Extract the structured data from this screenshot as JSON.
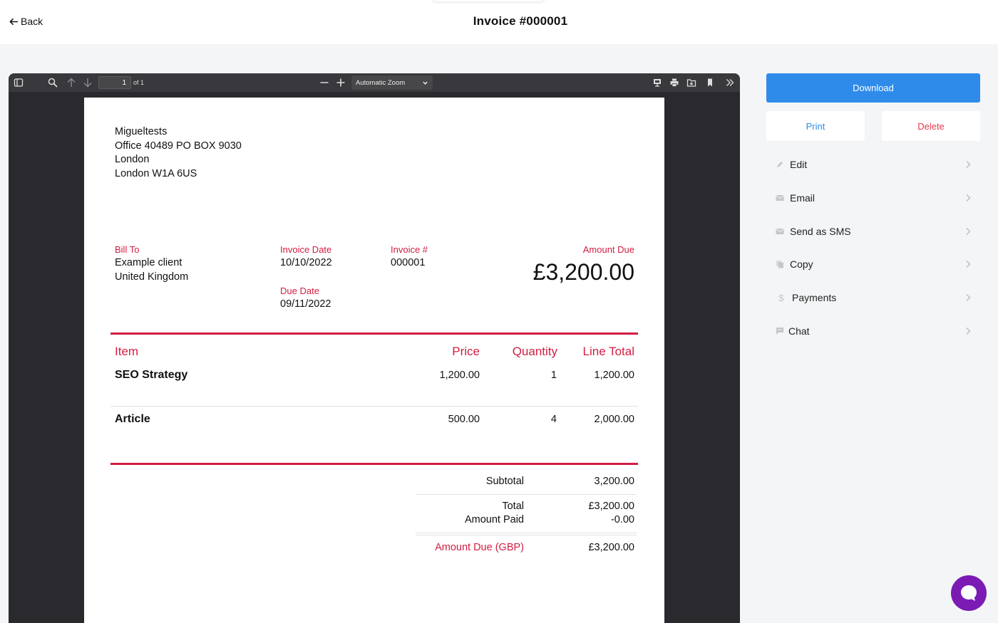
{
  "header": {
    "back_label": "Back",
    "title": "Invoice #000001"
  },
  "viewer": {
    "current_page": "1",
    "page_count_label": "of 1",
    "zoom_label": "Automatic Zoom"
  },
  "invoice": {
    "from": [
      "Migueltests",
      "Office 40489 PO BOX 9030",
      "London",
      "London W1A 6US"
    ],
    "bill_to_label": "Bill To",
    "bill_to": [
      "Example client",
      "United Kingdom"
    ],
    "invoice_date_label": "Invoice Date",
    "invoice_date": "10/10/2022",
    "due_date_label": "Due Date",
    "due_date": "09/11/2022",
    "invoice_no_label": "Invoice #",
    "invoice_no": "000001",
    "amount_due_label": "Amount Due",
    "amount_due": "£3,200.00",
    "columns": {
      "item": "Item",
      "price": "Price",
      "quantity": "Quantity",
      "line_total": "Line Total"
    },
    "items": [
      {
        "name": "SEO Strategy",
        "price": "1,200.00",
        "quantity": "1",
        "total": "1,200.00"
      },
      {
        "name": "Article",
        "price": "500.00",
        "quantity": "4",
        "total": "2,000.00"
      }
    ],
    "subtotal_label": "Subtotal",
    "subtotal": "3,200.00",
    "total_label": "Total",
    "total": "£3,200.00",
    "amount_paid_label": "Amount Paid",
    "amount_paid": "-0.00",
    "amount_due_gbp_label": "Amount Due (GBP)",
    "amount_due_gbp": "£3,200.00"
  },
  "sidebar": {
    "download_label": "Download",
    "print_label": "Print",
    "delete_label": "Delete",
    "menu": [
      {
        "label": "Edit",
        "icon": "pencil-icon"
      },
      {
        "label": "Email",
        "icon": "envelope-icon"
      },
      {
        "label": "Send as SMS",
        "icon": "envelope-icon"
      },
      {
        "label": "Copy",
        "icon": "copy-icon"
      },
      {
        "label": "Payments",
        "icon": "dollar-icon"
      },
      {
        "label": "Chat",
        "icon": "chat-icon"
      }
    ]
  },
  "colors": {
    "accent_blue": "#2f8bea",
    "invoice_red": "#d21d41",
    "chat_purple": "#7b1bb4",
    "delete_red": "#e53b4f"
  }
}
